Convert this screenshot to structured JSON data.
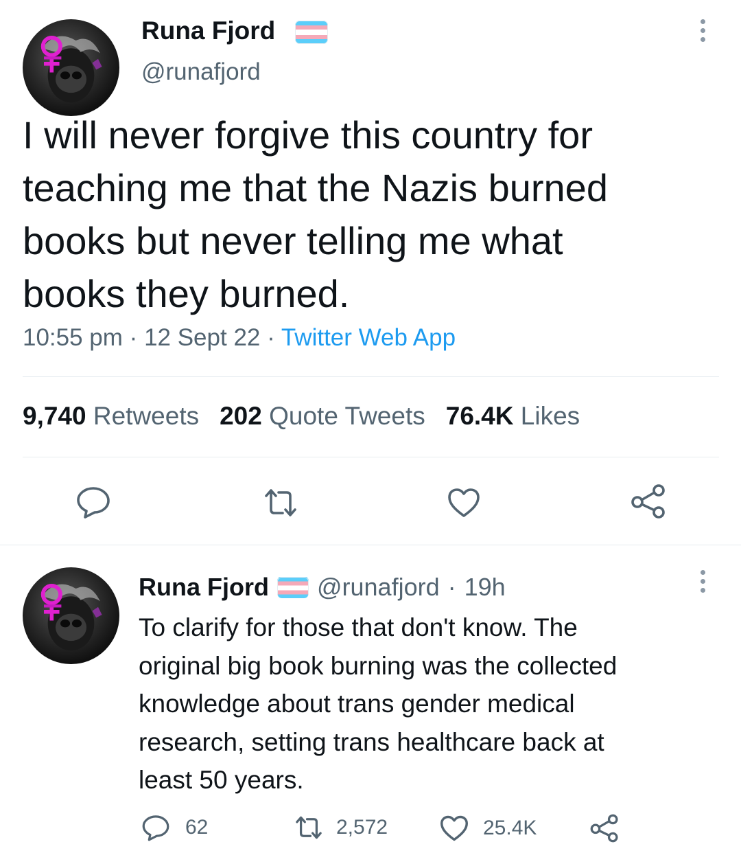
{
  "main_tweet": {
    "author_name": "Runa Fjord",
    "author_handle": "@runafjord",
    "text_lines": [
      "I will never forgive this country for",
      "teaching me that the Nazis burned",
      "books but never telling me what",
      "books they burned."
    ],
    "time": "10:55 pm",
    "date": "12 Sept 22",
    "source": "Twitter Web App",
    "separator": "·",
    "stats": {
      "retweets_count": "9,740",
      "retweets_label": "Retweets",
      "quotes_count": "202",
      "quotes_label": "Quote Tweets",
      "likes_count": "76.4K",
      "likes_label": "Likes"
    }
  },
  "reply_tweet": {
    "author_name": "Runa Fjord",
    "author_handle": "@runafjord",
    "separator": "·",
    "time_ago": "19h",
    "text_lines": [
      "To clarify for those that don't know. The",
      "original big book burning was the collected",
      "knowledge about trans gender medical",
      "research, setting trans healthcare back at",
      "least 50 years."
    ],
    "replies": "62",
    "retweets": "2,572",
    "likes": "25.4K"
  },
  "colors": {
    "text": "#0f1419",
    "secondary": "#536471",
    "link": "#1d9bf0",
    "flag_blue": "#5bcefa",
    "flag_pink": "#f5a9b8",
    "flag_white": "#ffffff"
  },
  "icons": [
    "more-icon",
    "reply-icon",
    "retweet-icon",
    "like-icon",
    "share-icon",
    "trans-flag-icon"
  ]
}
